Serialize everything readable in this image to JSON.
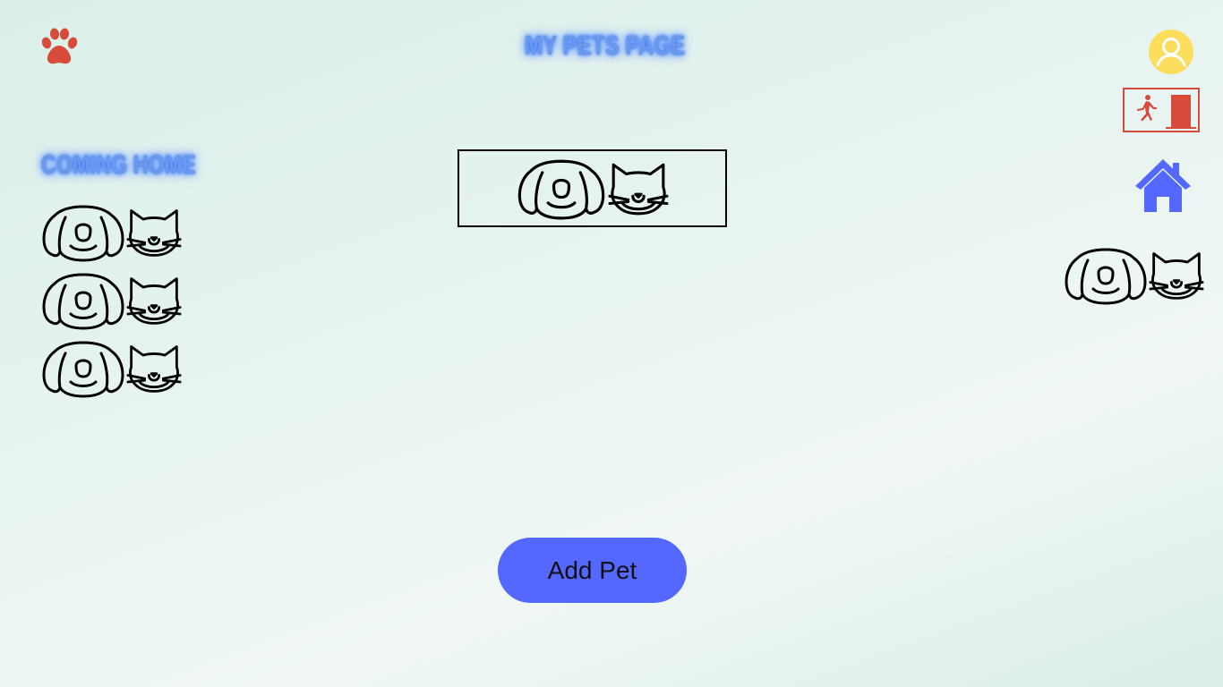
{
  "header": {
    "title": "MY PETS PAGE",
    "logo_icon": "paw-icon",
    "profile_icon": "user-avatar-icon",
    "exit_icon": "exit-door-icon",
    "home_icon": "home-icon"
  },
  "sidebar": {
    "title": "COMING HOME",
    "items": [
      {
        "icons": [
          "dog-icon",
          "cat-icon"
        ]
      },
      {
        "icons": [
          "dog-icon",
          "cat-icon"
        ]
      },
      {
        "icons": [
          "dog-icon",
          "cat-icon"
        ]
      }
    ]
  },
  "featured": {
    "icons": [
      "dog-icon",
      "cat-icon"
    ]
  },
  "right_panel": {
    "icons": [
      "dog-icon",
      "cat-icon"
    ]
  },
  "actions": {
    "add_pet_label": "Add Pet"
  },
  "colors": {
    "accent": "#5468ff",
    "logo": "#d84a3a",
    "avatar": "#fddd5c",
    "home": "#5468ff",
    "title_glow": "#3d7bff"
  }
}
